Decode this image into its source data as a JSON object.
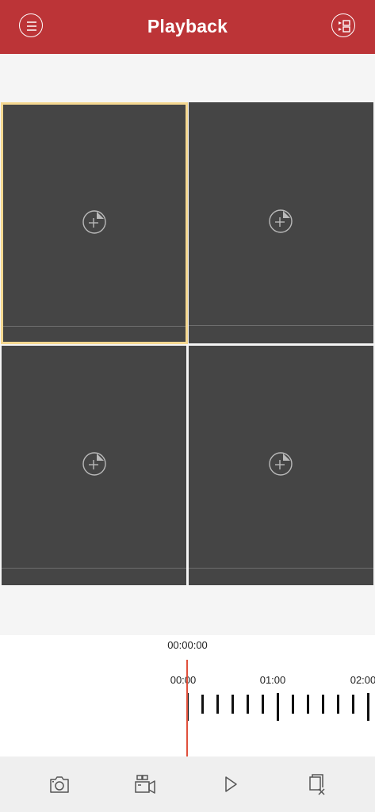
{
  "header": {
    "title": "Playback",
    "menu_icon": "menu-icon",
    "layout_icon": "channel-list-icon",
    "background_color": "#bc3437"
  },
  "grid": {
    "tiles": [
      {
        "state": "empty",
        "selected": true,
        "icon": "add-camera-icon"
      },
      {
        "state": "empty",
        "selected": false,
        "icon": "add-camera-icon"
      },
      {
        "state": "empty",
        "selected": false,
        "icon": "add-camera-icon"
      },
      {
        "state": "empty",
        "selected": false,
        "icon": "add-camera-icon"
      }
    ],
    "selected_border_color": "#f5d891",
    "tile_color": "#454545"
  },
  "timeline": {
    "current_time": "00:00:00",
    "labels": [
      "00:00",
      "01:00",
      "02:00"
    ],
    "cursor_color": "#e0503c"
  },
  "toolbar": {
    "tools": [
      "snapshot-icon",
      "record-clip-icon",
      "play-icon",
      "close-all-icon"
    ]
  }
}
